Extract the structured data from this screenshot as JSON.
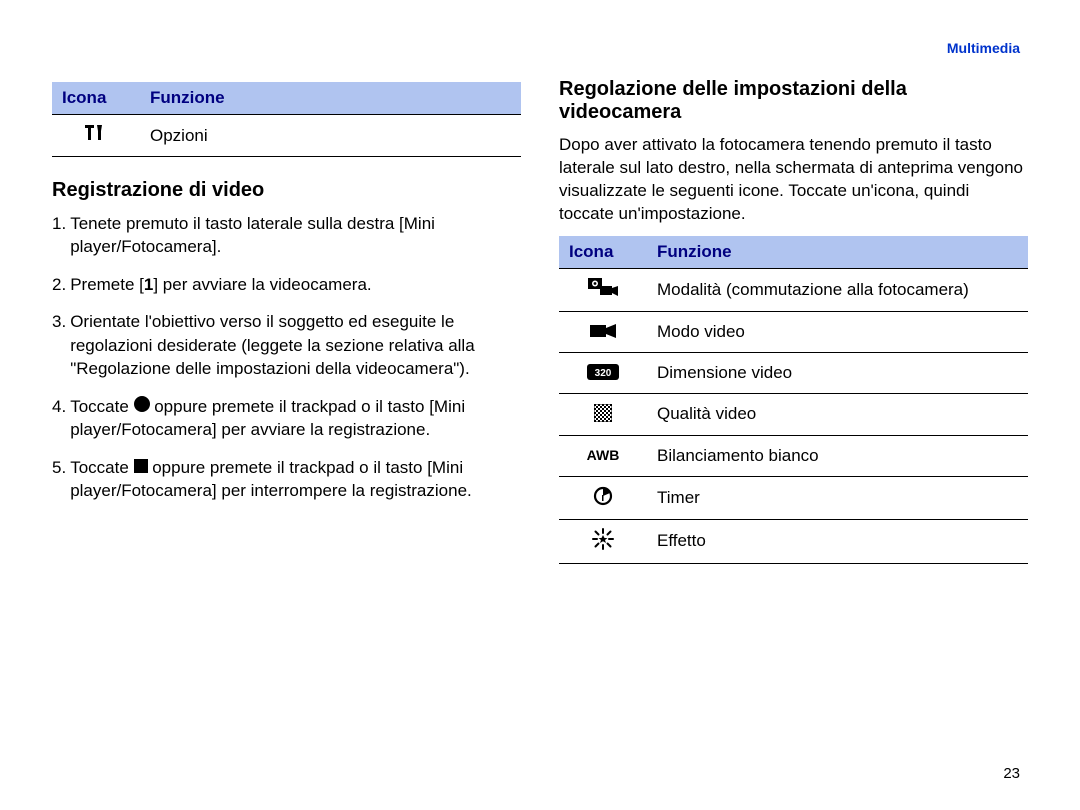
{
  "header": {
    "breadcrumb": "Multimedia"
  },
  "left": {
    "table": {
      "head_icon": "Icona",
      "head_func": "Funzione",
      "row0": {
        "label": "Opzioni"
      }
    },
    "heading": "Registrazione di video",
    "steps": [
      {
        "n": "1.",
        "text": "Tenete premuto il tasto laterale sulla destra [Mini player/Fotocamera]."
      },
      {
        "n": "2.",
        "text_a": "Premete [",
        "bold": "1",
        "text_b": "] per avviare la videocamera."
      },
      {
        "n": "3.",
        "text": "Orientate l'obiettivo verso il soggetto ed eseguite le regolazioni desiderate (leggete la sezione relativa alla \"Regolazione delle impostazioni della videocamera\")."
      },
      {
        "n": "4.",
        "text_a": "Toccate ",
        "text_b": " oppure premete il trackpad o il tasto [Mini player/Fotocamera] per avviare la registrazione."
      },
      {
        "n": "5.",
        "text_a": "Toccate ",
        "text_b": " oppure premete il trackpad o il tasto [Mini player/Fotocamera] per interrompere la registrazione."
      }
    ]
  },
  "right": {
    "heading": "Regolazione delle impostazioni della videocamera",
    "lead": "Dopo aver attivato la fotocamera tenendo premuto il tasto laterale sul lato destro, nella schermata di anteprima vengono visualizzate le seguenti icone. Toccate un'icona, quindi toccate un'impostazione.",
    "table": {
      "head_icon": "Icona",
      "head_func": "Funzione",
      "rows": [
        {
          "label": "Modalità (commutazione alla fotocamera)"
        },
        {
          "label": "Modo video"
        },
        {
          "label": "Dimensione video"
        },
        {
          "label": "Qualità video"
        },
        {
          "label": "Bilanciamento bianco"
        },
        {
          "label": "Timer"
        },
        {
          "label": "Effetto"
        }
      ]
    }
  },
  "page_number": "23"
}
